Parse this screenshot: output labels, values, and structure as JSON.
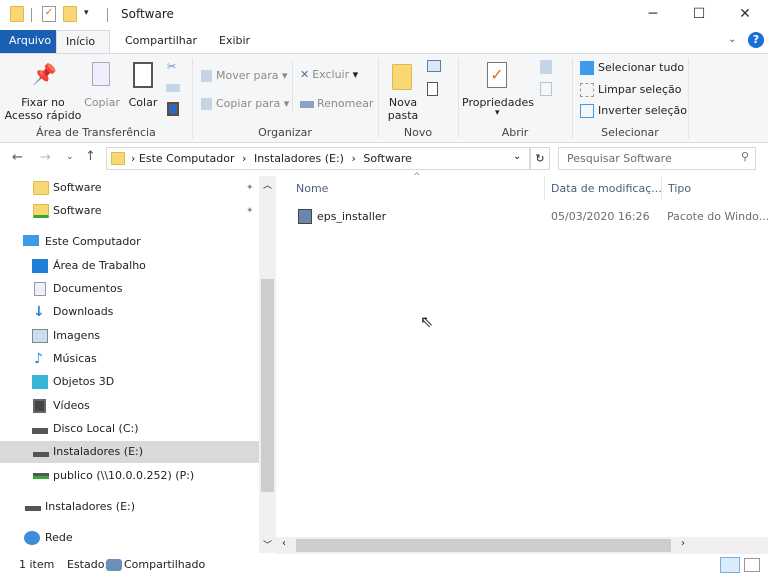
{
  "window": {
    "title": "Software",
    "minimize_icon": "minimize-icon",
    "maximize_icon": "maximize-icon",
    "close_icon": "close-icon"
  },
  "ribbon_tabs": [
    "Arquivo",
    "Início",
    "Compartilhar",
    "Exibir"
  ],
  "ribbon": {
    "clipboard": {
      "label": "Área de Transferência",
      "pin": "Fixar no\nAcesso rápido",
      "pin_l1": "Fixar no",
      "pin_l2": "Acesso rápido",
      "copy": "Copiar",
      "paste": "Colar"
    },
    "organize": {
      "label": "Organizar",
      "move": "Mover para",
      "copy_to": "Copiar para",
      "delete": "Excluir",
      "rename": "Renomear"
    },
    "new": {
      "label": "Novo",
      "new_folder_l1": "Nova",
      "new_folder_l2": "pasta"
    },
    "open": {
      "label": "Abrir",
      "properties": "Propriedades"
    },
    "select": {
      "label": "Selecionar",
      "select_all": "Selecionar tudo",
      "select_none": "Limpar seleção",
      "invert": "Inverter seleção"
    }
  },
  "address": {
    "crumbs": [
      "Este Computador",
      "Instaladores (E:)",
      "Software"
    ],
    "search_placeholder": "Pesquisar Software"
  },
  "nav": {
    "quick": [
      {
        "label": "Software"
      },
      {
        "label": "Software"
      }
    ],
    "this_pc": "Este Computador",
    "pc_items": [
      "Área de Trabalho",
      "Documentos",
      "Downloads",
      "Imagens",
      "Músicas",
      "Objetos 3D",
      "Vídeos",
      "Disco Local (C:)",
      "Instaladores (E:)",
      "publico (\\\\10.0.0.252) (P:)"
    ],
    "drive": "Instaladores (E:)",
    "network": "Rede"
  },
  "columns": [
    "Nome",
    "Data de modificaç...",
    "Tipo"
  ],
  "files": [
    {
      "name": "eps_installer",
      "modified": "05/03/2020 16:26",
      "type": "Pacote do Windo..."
    }
  ],
  "status": {
    "count": "1 item",
    "state_label": "Estado:",
    "state": "Compartilhado"
  },
  "colors": {
    "accent": "#1a5fb4",
    "selected": "#d9d9d9"
  }
}
